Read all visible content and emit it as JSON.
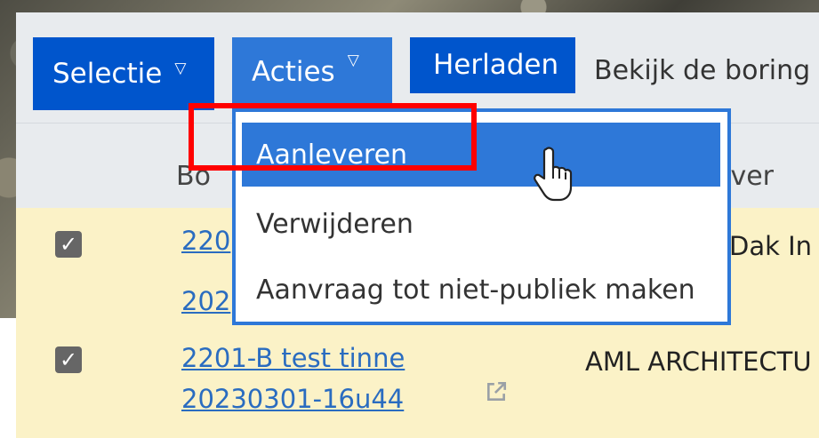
{
  "toolbar": {
    "selectie_label": "Selectie",
    "acties_label": "Acties",
    "herladen_label": "Herladen",
    "info_text": "Bekijk de boring"
  },
  "table": {
    "headers": [
      "Bo",
      "ever"
    ],
    "rows": [
      {
        "checked": true,
        "link_lines": [
          "220",
          "202"
        ],
        "extra": "Dak In"
      },
      {
        "checked": true,
        "link_lines": [
          "2201-B test tinne",
          "20230301-16u44"
        ],
        "extra": "AML ARCHITECTU"
      }
    ]
  },
  "dropdown": {
    "items": [
      "Aanleveren",
      "Verwijderen",
      "Aanvraag tot niet-publiek maken"
    ],
    "highlighted_index": 0
  },
  "icons": {
    "caret": "caret-down-icon",
    "external_link": "external-link-icon",
    "cursor": "hand-pointer-cursor"
  },
  "colors": {
    "primary": "#0055cc",
    "primary_active": "#2e78d8",
    "highlight_box": "#ff0000",
    "row_bg": "#fbf2c7",
    "link": "#2a6cc0"
  }
}
